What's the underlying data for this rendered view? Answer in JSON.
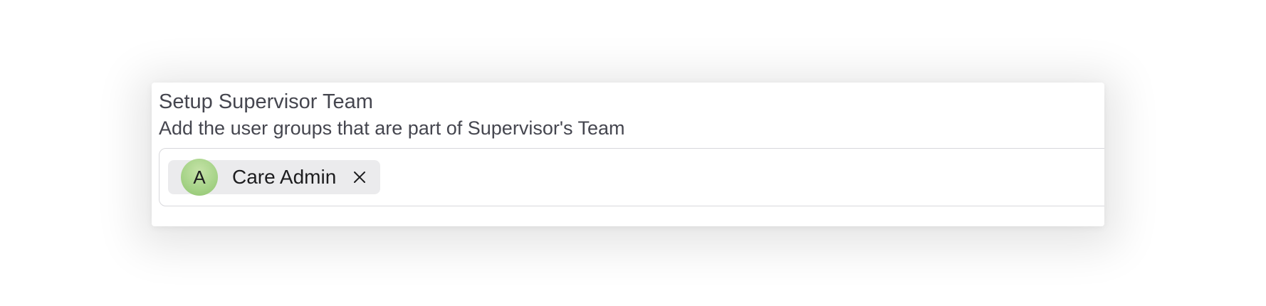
{
  "section": {
    "title": "Setup Supervisor Team",
    "description": "Add the user groups that are part of Supervisor's Team"
  },
  "selected_groups": [
    {
      "avatar_letter": "A",
      "label": "Care Admin",
      "remove_icon": "close-icon"
    }
  ],
  "colors": {
    "avatar_bg": "#a8d48a",
    "chip_bg": "#ebebed",
    "text": "#45464f"
  }
}
